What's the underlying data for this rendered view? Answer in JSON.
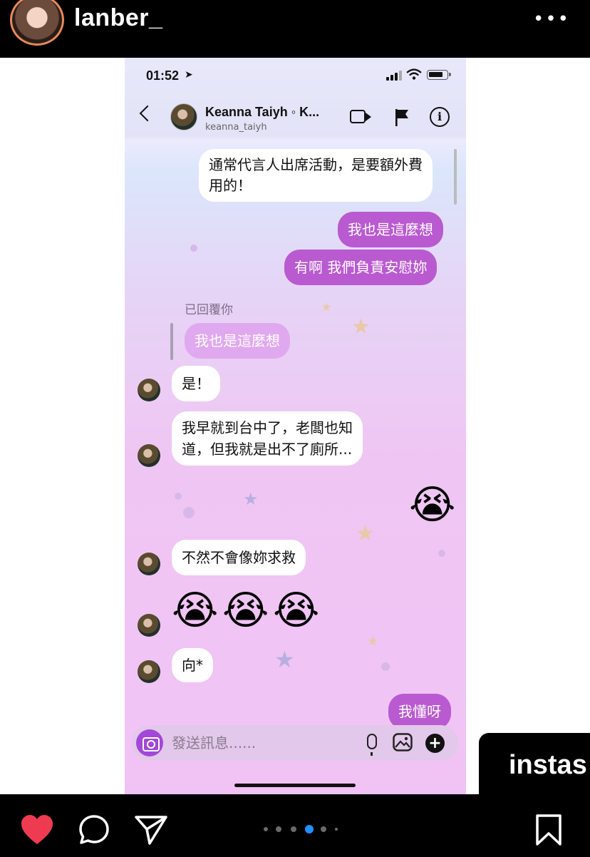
{
  "story": {
    "username": "lanber_",
    "more_label": "•••"
  },
  "status_bar": {
    "time": "01:52",
    "location_arrow": "➤"
  },
  "header": {
    "name": "Keanna Taiyh ◦ K...",
    "handle": "keanna_taiyh",
    "info_glyph": "i"
  },
  "messages": {
    "m1_line1": "通常代言人出席活動，是要額外費",
    "m1_line2": "用的！",
    "m2": "我也是這麼想",
    "m3": "有啊 我們負責安慰妳",
    "reply_label": "已回覆你",
    "reply_quote": "我也是這麼想",
    "m4": "是！",
    "m5_line1": "我早就到台中了，老闆也知",
    "m5_line2": "道，但我就是出不了廁所...",
    "m6_emoji": "😭",
    "m7": "不然不會像妳求救",
    "m8_emoji_1": "😭",
    "m8_emoji_2": "😭",
    "m8_emoji_3": "😭",
    "m9": "向*",
    "m10": "我懂呀"
  },
  "composer": {
    "placeholder": "發送訊息......",
    "plus_glyph": "+"
  },
  "watermark": {
    "text": "instas"
  },
  "pager": {
    "count": 6,
    "active_index": 3
  },
  "colors": {
    "outgoing_bubble": "#b95ad1",
    "reply_bubble": "#e0a9ef",
    "heart": "#ef3b51",
    "pager_active": "#1e90ff"
  }
}
